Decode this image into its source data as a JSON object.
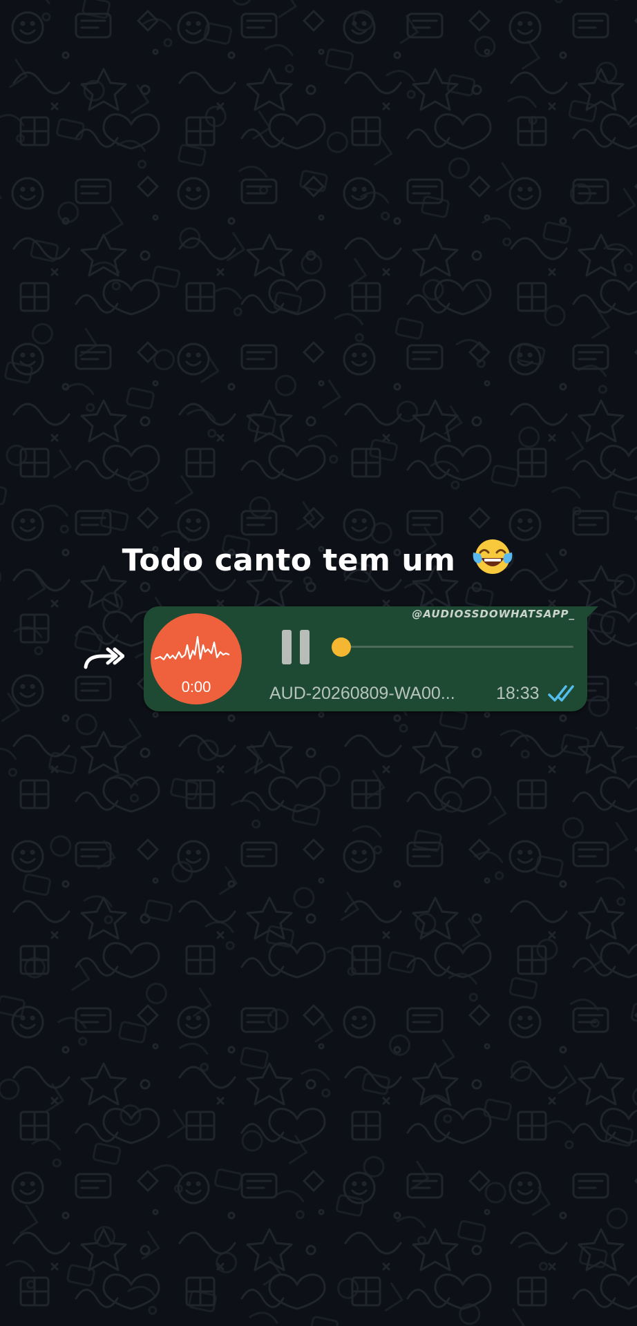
{
  "caption": {
    "text": "Todo canto tem um",
    "emoji": "face-with-tears-of-joy"
  },
  "message": {
    "watermark": "@AUDIOSSDOWHATSAPP_",
    "voice_duration": "0:00",
    "filename": "AUD-20260809-WA00...",
    "time": "18:33",
    "status": "read",
    "playback_progress": 0.0,
    "playing": true
  },
  "colors": {
    "background": "#0d1016",
    "bubble": "#1e4a33",
    "avatar": "#ef603c",
    "progress": "#f5b731",
    "read_ticks": "#53bdeb"
  },
  "icons": [
    "forward-icon",
    "pause-icon",
    "waveform-icon",
    "double-check-icon",
    "laughing-emoji-icon"
  ]
}
